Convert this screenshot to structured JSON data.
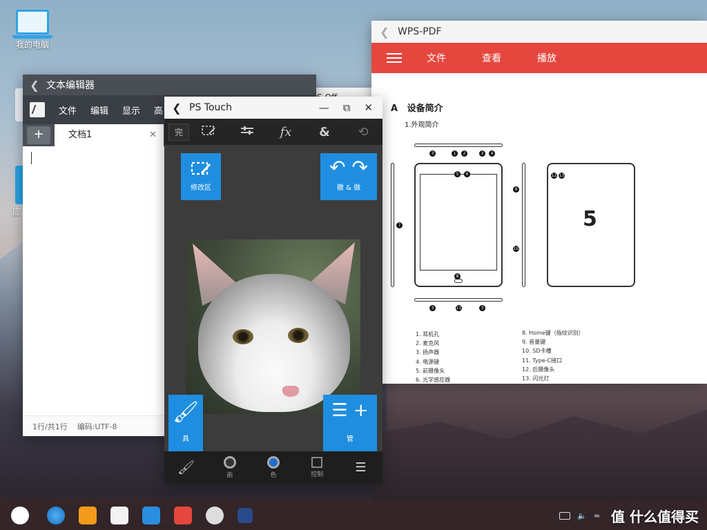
{
  "desktop": {
    "my_computer_label": "我的电脑",
    "partial_label": "应"
  },
  "editor": {
    "title": "文本编辑器",
    "menu": [
      "文件",
      "编辑",
      "显示",
      "高"
    ],
    "tab_label": "文档1",
    "tab_close": "✕",
    "add_tab": "+",
    "status_position": "1行/共1行",
    "status_encoding": "编码:UTF-8"
  },
  "wps_office": {
    "title_partial": "WPS Off"
  },
  "pdf": {
    "title": "WPS-PDF",
    "menu": [
      "文件",
      "查看",
      "播放"
    ],
    "heading_letter": "A",
    "heading": "设备简介",
    "subheading": "1.外观简介",
    "legend_left": [
      "1.  耳机孔",
      "2.  麦克风",
      "3.  扬声器",
      "4.  电源键",
      "5.  前摄像头",
      "6.  光学感应器"
    ],
    "legend_right": [
      "8.   Home键（指纹识别）",
      "9.   音量键",
      "10.  SD卡槽",
      "11.  Type-C接口",
      "12.  后摄像头",
      "13.  闪光灯"
    ],
    "callouts": [
      "3",
      "1",
      "2",
      "3",
      "4",
      "5",
      "6",
      "7",
      "8",
      "9",
      "10",
      "3",
      "11",
      "3",
      "12",
      "13"
    ],
    "logo": "5"
  },
  "ps": {
    "title": "PS Touch",
    "done_label": "完",
    "fx_label": "fx",
    "amp_label": "&",
    "modify_label": "修改区",
    "undo_redo_label": "撤 & 做",
    "tools_label": "具",
    "layers_label": "管",
    "bottom_labels": [
      "",
      "画",
      "色",
      "控制",
      ""
    ]
  },
  "taskbar": {
    "watermark": "值 什么值得买"
  },
  "colors": {
    "pdf_accent": "#e5473f",
    "ps_blue": "#1f8ee0",
    "editor_dark": "#3a3f45"
  }
}
